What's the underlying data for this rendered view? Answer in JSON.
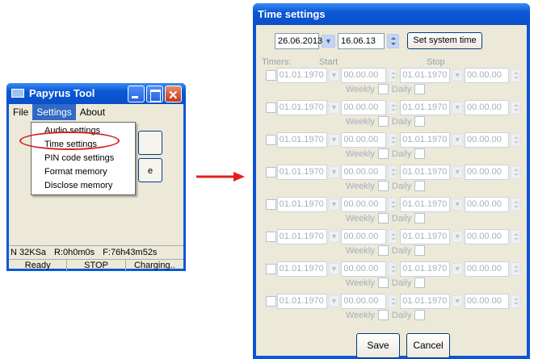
{
  "papyrus": {
    "title": "Papyrus Tool",
    "menu": [
      "File",
      "Settings",
      "About"
    ],
    "dropdown": [
      "Audio settings",
      "Time settings",
      "PIN code settings",
      "Format memory",
      "Disclose memory"
    ],
    "button_partial": "e",
    "status1": [
      "N 32KSa",
      "R:0h0m0s",
      "F:76h43m52s"
    ],
    "status2": [
      "Ready",
      "STOP",
      "Charging.."
    ]
  },
  "time_settings": {
    "title": "Time settings",
    "date_value": "26.06.2013",
    "date2_value": "16.06.13",
    "set_system_time": "Set system time",
    "headers": {
      "timers": "Timers:",
      "start": "Start",
      "stop": "Stop"
    },
    "timer_row": {
      "date": "01.01.1970",
      "time": "00.00.00",
      "weekly": "Weekly",
      "daily": "Daily"
    },
    "save": "Save",
    "cancel": "Cancel"
  },
  "colors": {
    "xp_blue": "#0a59d8",
    "highlight_red": "#d42020",
    "arrow_red": "#e02020"
  }
}
